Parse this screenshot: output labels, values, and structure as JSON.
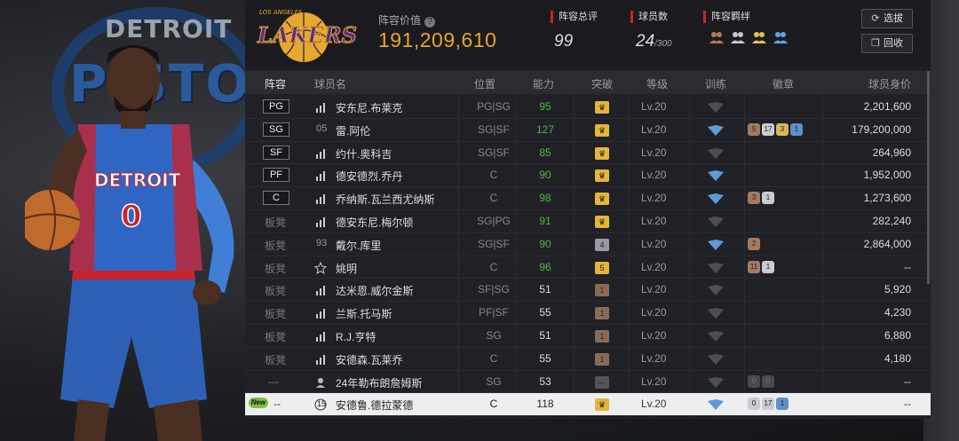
{
  "team": {
    "logo_text": "LAKERS",
    "logo_top": "LOS ANGELES",
    "value_label": "阵容价值",
    "value": "191,209,610"
  },
  "art": {
    "logo_text": "PISTON",
    "logo_top": "DETROIT",
    "jersey_text": "DETROIT",
    "jersey_number": "0"
  },
  "stats": {
    "rating_label": "阵容总评",
    "rating": "99",
    "count_label": "球员数",
    "count": "24",
    "count_max": "/300",
    "bond_label": "阵容羁绊"
  },
  "buttons": {
    "filter": "选拔",
    "back": "回收"
  },
  "columns": {
    "lineup": "阵容",
    "name": "球员名",
    "position": "位置",
    "ability": "能力",
    "breakthrough": "突破",
    "level": "等级",
    "training": "训练",
    "badges": "徽章",
    "price": "球员身价"
  },
  "rows": [
    {
      "lineup": "PG",
      "lineup_type": "pos",
      "icon": "bars",
      "num": "",
      "name": "安东尼.布莱克",
      "pos": "PG|SG",
      "ability": "95",
      "ability_color": "green",
      "brk": "gold",
      "brk_text": "♛",
      "level": "Lv.20",
      "train": "dark",
      "badges": [],
      "price": "2,201,600"
    },
    {
      "lineup": "SG",
      "lineup_type": "pos",
      "icon": "",
      "num": "05",
      "name": "雷.阿伦",
      "pos": "SG|SF",
      "ability": "127",
      "ability_color": "green",
      "brk": "gold",
      "brk_text": "♛",
      "level": "Lv.20",
      "train": "blue",
      "badges": [
        {
          "t": "5",
          "c": "b"
        },
        {
          "t": "17",
          "c": "s"
        },
        {
          "t": "3",
          "c": "g"
        },
        {
          "t": "1",
          "c": "bl"
        }
      ],
      "price": "179,200,000"
    },
    {
      "lineup": "SF",
      "lineup_type": "pos",
      "icon": "bars",
      "num": "",
      "name": "约什.奥科吉",
      "pos": "SG|SF",
      "ability": "85",
      "ability_color": "green",
      "brk": "gold",
      "brk_text": "♛",
      "level": "Lv.20",
      "train": "dark",
      "badges": [],
      "price": "264,960"
    },
    {
      "lineup": "PF",
      "lineup_type": "pos",
      "icon": "bars",
      "num": "",
      "name": "德安德烈.乔丹",
      "pos": "C",
      "ability": "90",
      "ability_color": "green",
      "brk": "gold",
      "brk_text": "♛",
      "level": "Lv.20",
      "train": "blue",
      "badges": [],
      "price": "1,952,000"
    },
    {
      "lineup": "C",
      "lineup_type": "pos",
      "icon": "bars",
      "num": "",
      "name": "乔纳斯.瓦兰西尤纳斯",
      "pos": "C",
      "ability": "98",
      "ability_color": "green",
      "brk": "gold",
      "brk_text": "♛",
      "level": "Lv.20",
      "train": "blue",
      "badges": [
        {
          "t": "3",
          "c": "b"
        },
        {
          "t": "1",
          "c": "s"
        }
      ],
      "price": "1,273,600"
    },
    {
      "lineup": "板凳",
      "lineup_type": "bench",
      "icon": "bars",
      "num": "",
      "name": "德安东尼.梅尔顿",
      "pos": "SG|PG",
      "ability": "91",
      "ability_color": "green",
      "brk": "gold",
      "brk_text": "♛",
      "level": "Lv.20",
      "train": "dark",
      "badges": [],
      "price": "282,240"
    },
    {
      "lineup": "板凳",
      "lineup_type": "bench",
      "icon": "",
      "num": "93",
      "name": "戴尔.库里",
      "pos": "SG|SF",
      "ability": "90",
      "ability_color": "green",
      "brk": "silver",
      "brk_text": "4",
      "level": "Lv.20",
      "train": "blue",
      "badges": [
        {
          "t": "2",
          "c": "b"
        }
      ],
      "price": "2,864,000"
    },
    {
      "lineup": "板凳",
      "lineup_type": "bench",
      "icon": "star",
      "num": "",
      "name": "姚明",
      "pos": "C",
      "ability": "96",
      "ability_color": "green",
      "brk": "gold",
      "brk_text": "5",
      "level": "Lv.20",
      "train": "dark",
      "badges": [
        {
          "t": "11",
          "c": "b"
        },
        {
          "t": "1",
          "c": "s"
        }
      ],
      "price": "--"
    },
    {
      "lineup": "板凳",
      "lineup_type": "bench",
      "icon": "bars",
      "num": "",
      "name": "达米恩.威尔金斯",
      "pos": "SF|SG",
      "ability": "51",
      "ability_color": "white",
      "brk": "bronze",
      "brk_text": "1",
      "level": "Lv.20",
      "train": "dark",
      "badges": [],
      "price": "5,920"
    },
    {
      "lineup": "板凳",
      "lineup_type": "bench",
      "icon": "bars",
      "num": "",
      "name": "兰斯.托马斯",
      "pos": "PF|SF",
      "ability": "55",
      "ability_color": "white",
      "brk": "bronze",
      "brk_text": "1",
      "level": "Lv.20",
      "train": "dark",
      "badges": [],
      "price": "4,230"
    },
    {
      "lineup": "板凳",
      "lineup_type": "bench",
      "icon": "bars",
      "num": "",
      "name": "R.J.亨特",
      "pos": "SG",
      "ability": "51",
      "ability_color": "white",
      "brk": "bronze",
      "brk_text": "1",
      "level": "Lv.20",
      "train": "dark",
      "badges": [],
      "price": "6,880"
    },
    {
      "lineup": "板凳",
      "lineup_type": "bench",
      "icon": "bars",
      "num": "",
      "name": "安德森.瓦莱乔",
      "pos": "C",
      "ability": "55",
      "ability_color": "white",
      "brk": "bronze",
      "brk_text": "1",
      "level": "Lv.20",
      "train": "dark",
      "badges": [],
      "price": "4,180"
    },
    {
      "lineup": "—",
      "lineup_type": "dash",
      "icon": "person",
      "num": "",
      "name": "24年勒布朗詹姆斯",
      "pos": "SG",
      "ability": "53",
      "ability_color": "white",
      "brk": "dark",
      "brk_text": "—",
      "level": "Lv.20",
      "train": "dark",
      "badges": [
        {
          "t": "0",
          "c": "d"
        },
        {
          "t": "0",
          "c": "d"
        }
      ],
      "price": "--"
    },
    {
      "lineup": "--",
      "lineup_type": "new",
      "new_label": "New",
      "icon": "circle",
      "num": "15",
      "name": "安德鲁.德拉蒙德",
      "pos": "C",
      "ability": "118",
      "ability_color": "white",
      "brk": "gold",
      "brk_text": "♛",
      "level": "Lv.20",
      "train": "blue",
      "badges": [
        {
          "t": "0",
          "c": "s"
        },
        {
          "t": "17",
          "c": "s"
        },
        {
          "t": "1",
          "c": "bl"
        }
      ],
      "price": "--",
      "selected": true
    }
  ]
}
